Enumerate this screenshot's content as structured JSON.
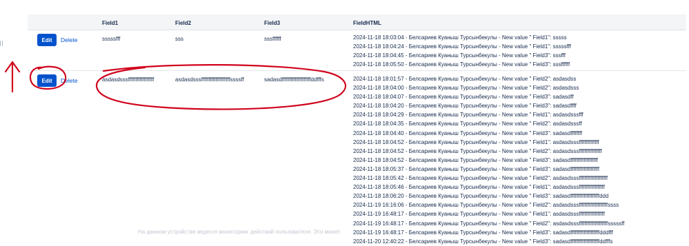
{
  "table": {
    "headers": [
      "Field1",
      "Field2",
      "Field3",
      "FieldHTML"
    ],
    "rows": [
      {
        "edit_label": "Edit",
        "delete_label": "Delete",
        "field1": "sssssfff",
        "field2": "sss",
        "field3": "sssffffff",
        "history": [
          "2024-11-18 18:03:04 - Белсариев Куаныш Турсынбекулы - New value \" Field1\": sssss",
          "2024-11-18 18:04:24 - Белсариев Куаныш Турсынбекулы - New value \" Field1\": sssssfff",
          "2024-11-18 18:04:45 - Белсариев Куаныш Турсынбекулы - New value \" Field3\": sssfff",
          "2024-11-18 18:05:50 - Белсариев Куаныш Турсынбекулы - New value \" Field3\": sssffffff"
        ]
      },
      {
        "edit_label": "Edit",
        "delete_label": "Delete",
        "field1": "asdasdsssffffffffffffffffff",
        "field2": "asdasdsssffffffffffffffffffffssssff",
        "field3": "sadasdffffffffffffffffffffddfffs",
        "history": [
          "2024-11-18 18:01:57 - Белсариев Куаныш Турсынбекулы - New value \" Field2\": asdasdss",
          "2024-11-18 18:04:00 - Белсариев Куаныш Турсынбекулы - New value \" Field2\": asdasdsss",
          "2024-11-18 18:04:07 - Белсариев Куаныш Турсынбекулы - New value \" Field3\": sadasdff",
          "2024-11-18 18:04:20 - Белсариев Куаныш Турсынбекулы - New value \" Field3\": sadasdffff",
          "2024-11-18 18:04:29 - Белсариев Куаныш Турсынбекулы - New value \" Field1\": asdasdsssfff",
          "2024-11-18 18:04:35 - Белсариев Куаныш Турсынбекулы - New value \" Field2\": asdasdsssff",
          "2024-11-18 18:04:40 - Белсариев Куаныш Турсынбекулы - New value \" Field3\": sadasdffffffff",
          "2024-11-18 18:04:52 - Белсариев Куаныш Турсынбекулы - New value \" Field1\": asdasdsssffffffffffffff",
          "2024-11-18 18:04:52 - Белсариев Куаныш Турсынбекулы - New value \" Field2\": asdasdsssffffffffffffffff",
          "2024-11-18 18:04:52 - Белсариев Куаныш Турсынбекулы - New value \" Field3\": sadasdfffffffffffffffffff",
          "2024-11-18 18:05:37 - Белсариев Куаныш Турсынбекулы - New value \" Field3\": sadasdffffffffffffffffffff",
          "2024-11-18 18:05:42 - Белсариев Куаныш Турсынбекулы - New value \" Field2\": asdasdsssffffffffffffffffffff",
          "2024-11-18 18:05:46 - Белсариев Куаныш Турсынбекулы - New value \" Field1\": asdasdsssffffffffffffffffff",
          "2024-11-18 18:06:20 - Белсариев Куаныш Турсынбекулы - New value \" Field3\": sadasdffffffffffffffffffffddd",
          "2024-11-19 16:16:06 - Белсариев Куаныш Турсынбекулы - New value \" Field2\": asdasdsssffffffffffffffffffffssss",
          "2024-11-19 16:48:17 - Белсариев Куаныш Турсынбекулы - New value \" Field1\": asdasdsssffffffffffffffffff",
          "2024-11-19 16:48:17 - Белсариев Куаныш Турсынбекулы - New value \" Field2\": asdasdsssffffffffffffffffffffsssssff",
          "2024-11-19 16:48:17 - Белсариев Куаныш Турсынбекулы - New value \" Field3\": sadasdffffffffffffffffffffdddfff",
          "2024-11-20 12:40:22 - Белсариев Куаныш Турсынбекулы - New value \" Field3\": sadasdffffffffffffffffffffddfffs"
        ]
      }
    ]
  },
  "footer_text": "На данном устройстве ведется мониторинг действий пользователя. Это может",
  "annotation_color": "#d0021b",
  "accent_color": "#0052cc"
}
